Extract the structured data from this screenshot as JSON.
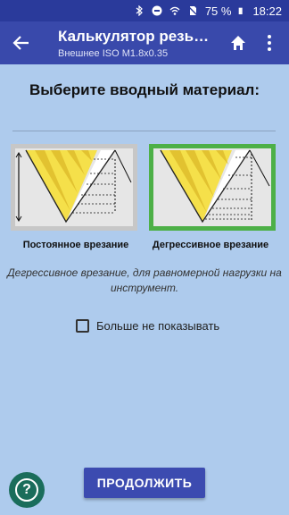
{
  "status_bar": {
    "battery": "75 %",
    "time": "18:22"
  },
  "app_bar": {
    "title": "Калькулятор резь…",
    "subtitle": "Внешнее ISO M1.8x0.35"
  },
  "heading": "Выберите вводный материал:",
  "options": [
    {
      "label": "Постоянное врезание",
      "selected": false
    },
    {
      "label": "Дегрессивное врезание",
      "selected": true
    }
  ],
  "description": "Дегрессивное врезание, для равномерной нагрузки на инструмент.",
  "checkbox": {
    "label": "Больше не показывать",
    "checked": false
  },
  "continue_button": "ПРОДОЛЖИТЬ",
  "help_button": "?",
  "colors": {
    "status_bar": "#2a3a9b",
    "app_bar": "#3949ab",
    "background": "#aecbed",
    "selected_border": "#4db047",
    "button": "#3c4bb0"
  }
}
